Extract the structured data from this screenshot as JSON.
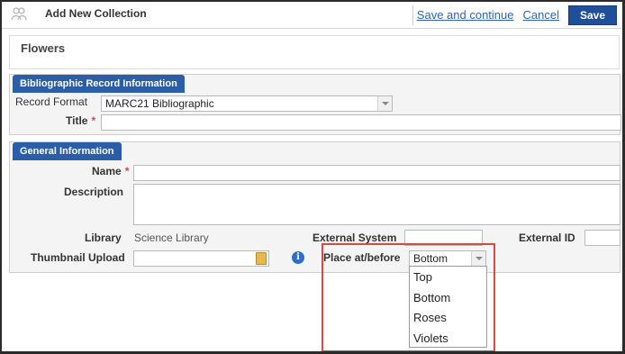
{
  "header": {
    "title": "Add New Collection",
    "icon": "collection-icon",
    "actions": {
      "save_continue": "Save and continue",
      "cancel": "Cancel",
      "save": "Save"
    }
  },
  "collection_name": "Flowers",
  "bibliographic": {
    "heading": "Bibliographic Record Information",
    "record_format_label": "Record Format",
    "record_format_value": "MARC21 Bibliographic",
    "title_label": "Title",
    "title_value": ""
  },
  "general": {
    "heading": "General Information",
    "name_label": "Name",
    "name_value": "",
    "description_label": "Description",
    "library_label": "Library",
    "library_value": "Science Library",
    "external_system_label": "External System",
    "external_id_label": "External ID",
    "thumbnail_label": "Thumbnail Upload",
    "place_label": "Place at/before",
    "place_selected": "Bottom",
    "place_options": [
      "Top",
      "Bottom",
      "Roses",
      "Violets"
    ]
  },
  "colors": {
    "section_header": "#2b5ea6",
    "save_button": "#1f4f9a",
    "link": "#2f64b1",
    "highlight": "#d94a3e",
    "required": "#d9453a"
  }
}
